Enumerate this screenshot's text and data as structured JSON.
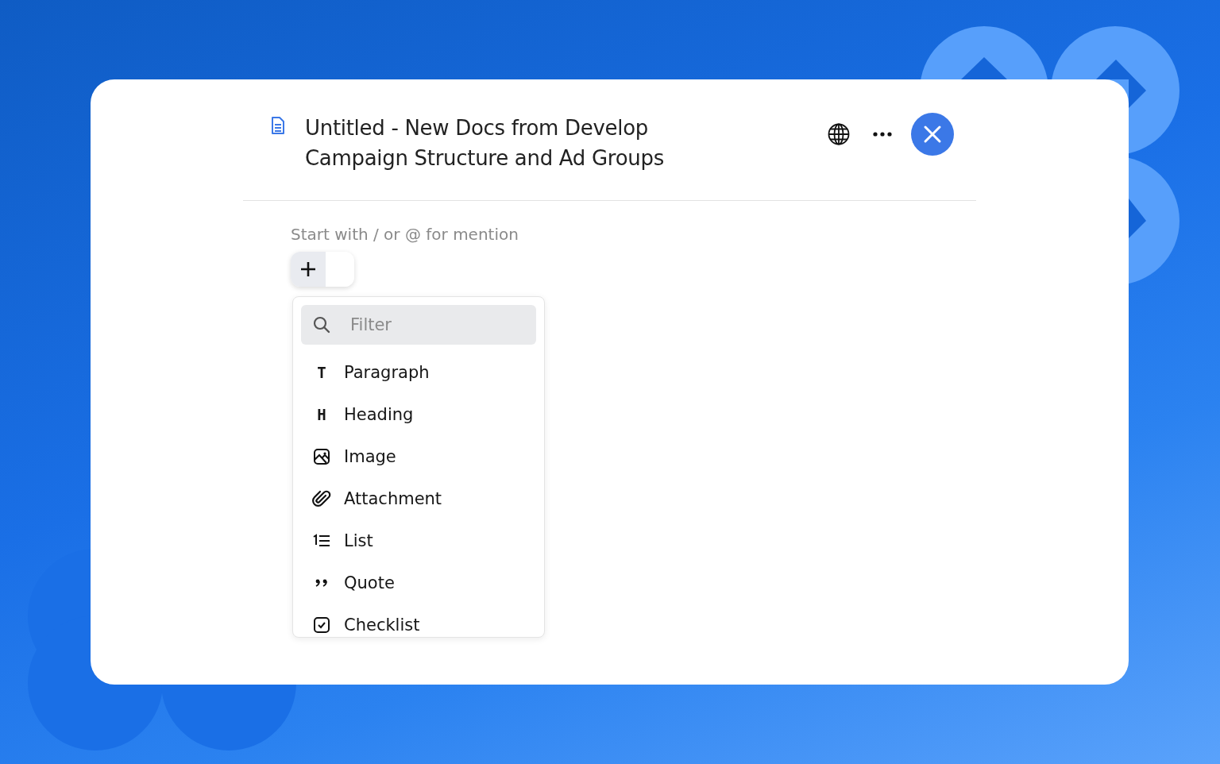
{
  "document": {
    "title_lines": [
      "Untitled - New Docs from Develop",
      "Campaign Structure and Ad Groups"
    ]
  },
  "editor": {
    "placeholder": "Start with / or @ for mention"
  },
  "block_menu": {
    "filter": {
      "placeholder": "Filter"
    },
    "items": [
      {
        "kind": "paragraph",
        "glyph": "T",
        "label": "Paragraph"
      },
      {
        "kind": "heading",
        "glyph": "H",
        "label": "Heading"
      },
      {
        "kind": "image",
        "label": "Image"
      },
      {
        "kind": "attachment",
        "label": "Attachment"
      },
      {
        "kind": "list",
        "label": "List"
      },
      {
        "kind": "quote",
        "label": "Quote"
      },
      {
        "kind": "checklist",
        "label": "Checklist"
      }
    ]
  }
}
